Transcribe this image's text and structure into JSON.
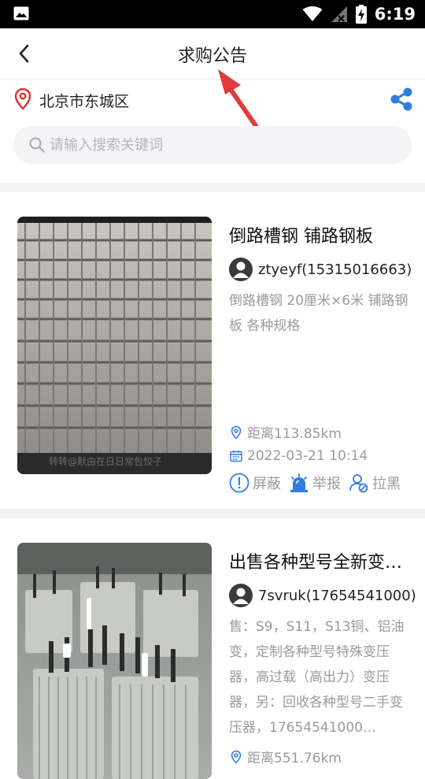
{
  "status_bar": {
    "time": "6:19"
  },
  "header": {
    "title": "求购公告"
  },
  "location": {
    "text": "北京市东城区"
  },
  "search": {
    "placeholder": "请输入搜索关键词"
  },
  "items": [
    {
      "title": "倒路槽钢 铺路钢板",
      "user": "ztyeyf(15315016663)",
      "description": "倒路槽钢 20厘米×6米 铺路钢板 各种规格",
      "distance": "距离113.85km",
      "date": "2022-03-21 10:14",
      "image_caption": "转转@默由在日日常包饺子",
      "actions": {
        "block": "屏蔽",
        "report": "举报",
        "blacklist": "拉黑"
      }
    },
    {
      "title": "出售各种型号全新变压器",
      "user": "7svruk(17654541000)",
      "description": "售：S9，S11，S13铜、铝油变，定制各种型号特殊变压器，高过载（高出力）变压器，另：回收各种型号二手变压器，17654541000…",
      "distance": "距离551.76km"
    }
  ],
  "colors": {
    "accent": "#2f7de1",
    "location_pin": "#e0312f",
    "arrow": "#e23b3b"
  }
}
